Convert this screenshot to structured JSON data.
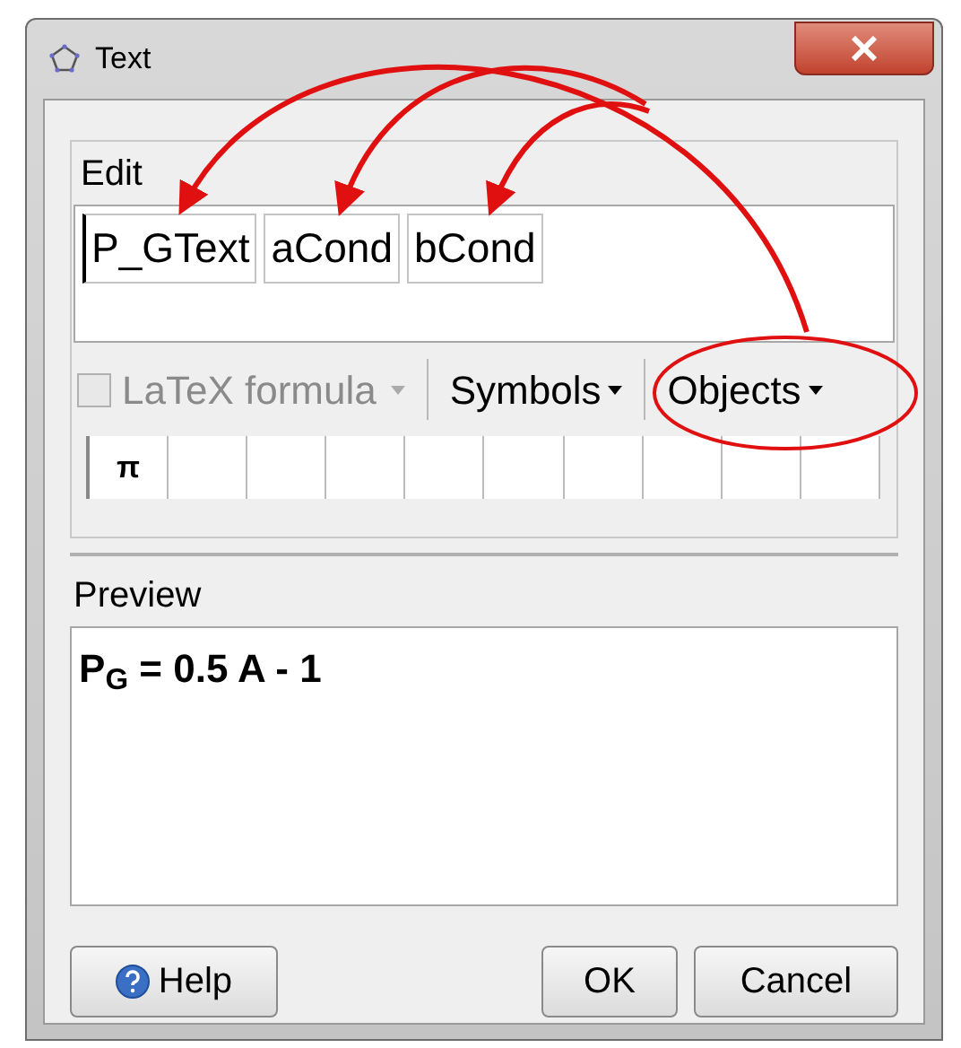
{
  "window": {
    "title": "Text"
  },
  "edit": {
    "label": "Edit",
    "chips": [
      {
        "text": "P_GText",
        "caret": true
      },
      {
        "text": "aCond",
        "caret": false
      },
      {
        "text": "bCond",
        "caret": false
      }
    ]
  },
  "toolbar": {
    "latex": {
      "label": "LaTeX formula",
      "checked": false,
      "disabled": true
    },
    "menus": [
      "Symbols",
      "Objects"
    ]
  },
  "symbols": [
    "π"
  ],
  "preview": {
    "label": "Preview",
    "text": "P$_{G}$ = 0.5 A - 1"
  },
  "buttons": {
    "help": "Help",
    "ok": "OK",
    "cancel": "Cancel"
  }
}
